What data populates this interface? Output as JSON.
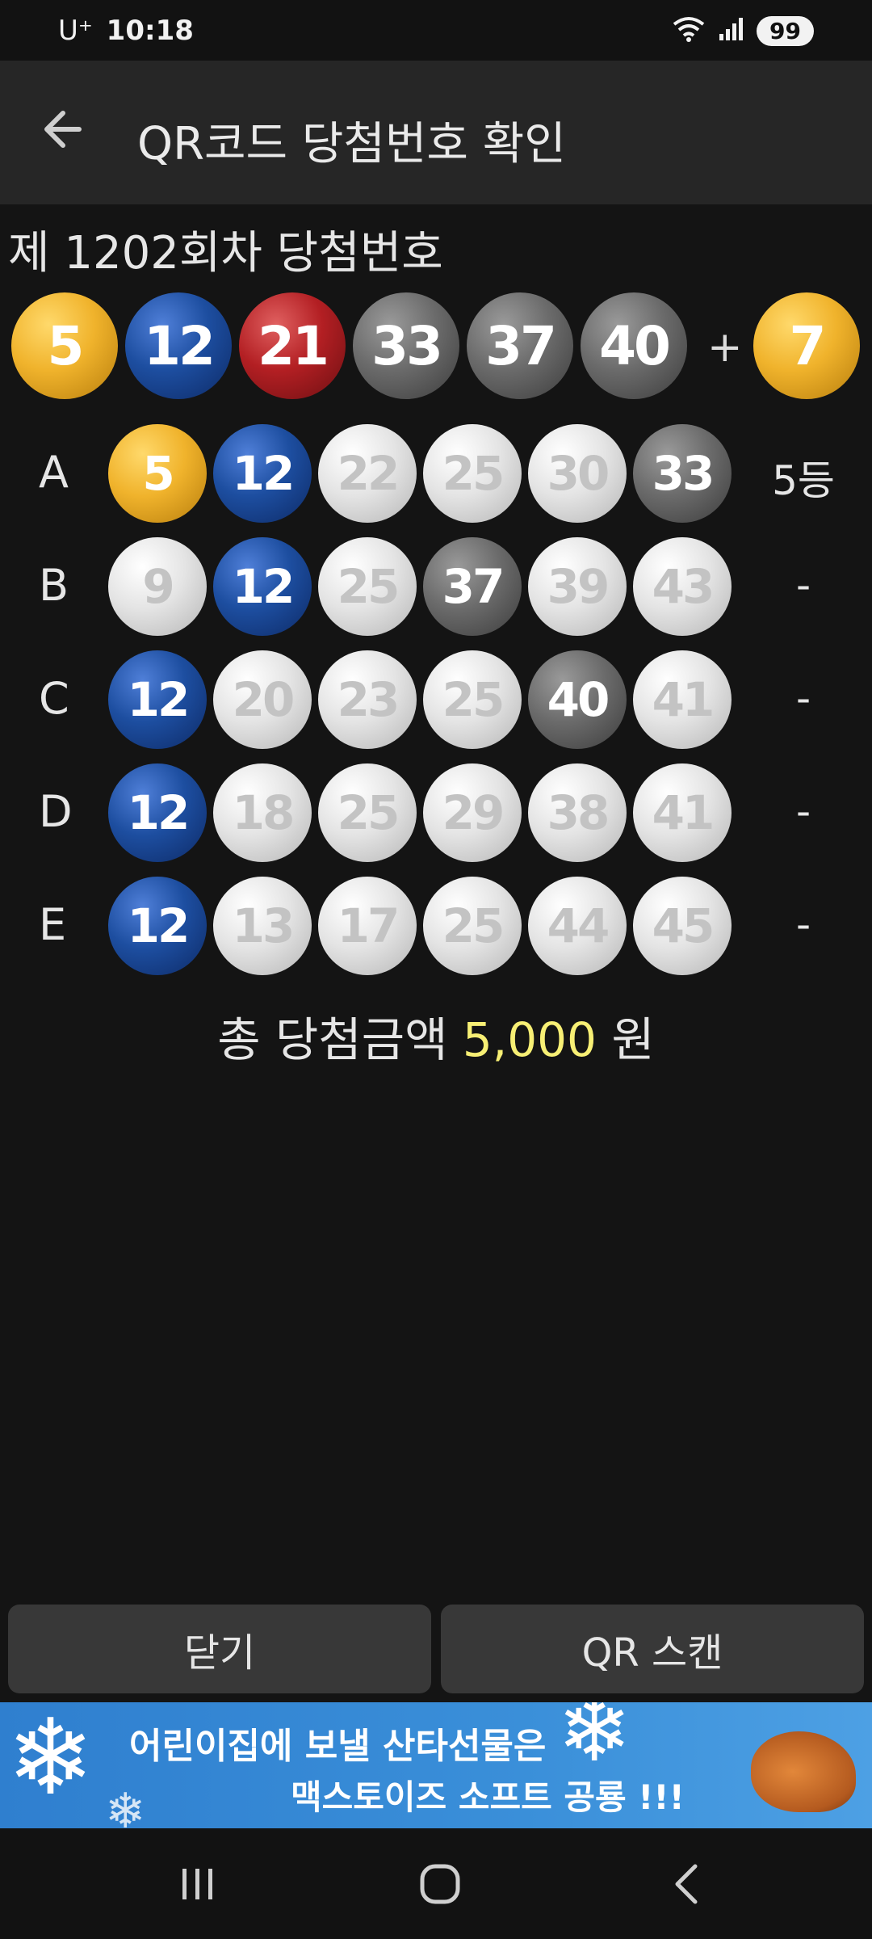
{
  "status_bar": {
    "carrier": "U⁺",
    "time": "10:18",
    "battery": "99"
  },
  "app_bar": {
    "title": "QR코드 당첨번호 확인"
  },
  "draw": {
    "title": "제 1202회차 당첨번호",
    "numbers": [
      {
        "value": "5",
        "color": "yellow"
      },
      {
        "value": "12",
        "color": "blue"
      },
      {
        "value": "21",
        "color": "red"
      },
      {
        "value": "33",
        "color": "gray"
      },
      {
        "value": "37",
        "color": "gray"
      },
      {
        "value": "40",
        "color": "gray"
      }
    ],
    "plus": "+",
    "bonus": {
      "value": "7",
      "color": "yellow"
    }
  },
  "games": [
    {
      "label": "A",
      "rank": "5등",
      "balls": [
        {
          "value": "5",
          "color": "yellow"
        },
        {
          "value": "12",
          "color": "blue"
        },
        {
          "value": "22",
          "color": "light"
        },
        {
          "value": "25",
          "color": "light"
        },
        {
          "value": "30",
          "color": "light"
        },
        {
          "value": "33",
          "color": "gray"
        }
      ]
    },
    {
      "label": "B",
      "rank": "-",
      "balls": [
        {
          "value": "9",
          "color": "light"
        },
        {
          "value": "12",
          "color": "blue"
        },
        {
          "value": "25",
          "color": "light"
        },
        {
          "value": "37",
          "color": "gray"
        },
        {
          "value": "39",
          "color": "light"
        },
        {
          "value": "43",
          "color": "light"
        }
      ]
    },
    {
      "label": "C",
      "rank": "-",
      "balls": [
        {
          "value": "12",
          "color": "blue"
        },
        {
          "value": "20",
          "color": "light"
        },
        {
          "value": "23",
          "color": "light"
        },
        {
          "value": "25",
          "color": "light"
        },
        {
          "value": "40",
          "color": "gray"
        },
        {
          "value": "41",
          "color": "light"
        }
      ]
    },
    {
      "label": "D",
      "rank": "-",
      "balls": [
        {
          "value": "12",
          "color": "blue"
        },
        {
          "value": "18",
          "color": "light"
        },
        {
          "value": "25",
          "color": "light"
        },
        {
          "value": "29",
          "color": "light"
        },
        {
          "value": "38",
          "color": "light"
        },
        {
          "value": "41",
          "color": "light"
        }
      ]
    },
    {
      "label": "E",
      "rank": "-",
      "balls": [
        {
          "value": "12",
          "color": "blue"
        },
        {
          "value": "13",
          "color": "light"
        },
        {
          "value": "17",
          "color": "light"
        },
        {
          "value": "25",
          "color": "light"
        },
        {
          "value": "44",
          "color": "light"
        },
        {
          "value": "45",
          "color": "light"
        }
      ]
    }
  ],
  "total": {
    "prefix": "총 당첨금액",
    "amount": "5,000",
    "unit": "원",
    "amount_color": "#f7ef74"
  },
  "buttons": {
    "close": "닫기",
    "scan": "QR 스캔"
  },
  "ad": {
    "line1": "어린이집에 보낼 산타선물은",
    "line2": "맥스토이즈 소프트 공룡 !!!"
  },
  "icons": {
    "back": "arrow-left-icon",
    "wifi": "wifi-icon",
    "signal": "signal-icon",
    "nav_recent": "recent-apps-icon",
    "nav_home": "home-icon",
    "nav_back": "back-icon"
  }
}
